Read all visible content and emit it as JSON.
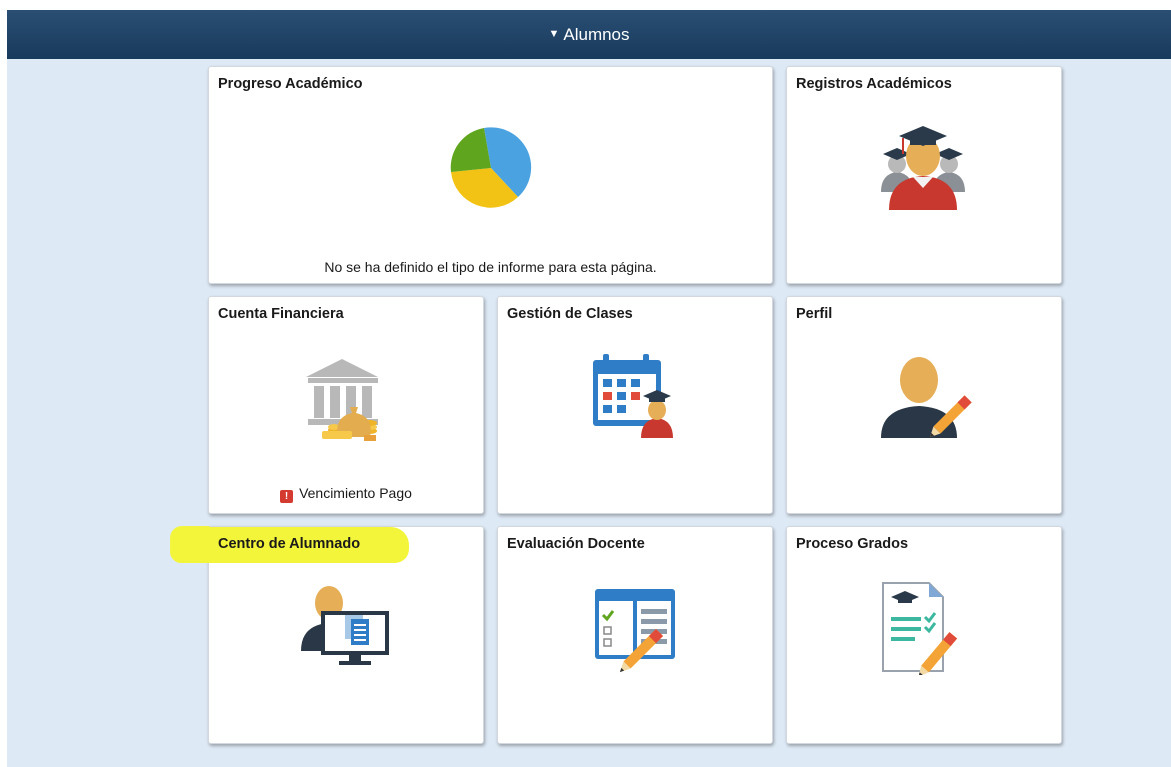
{
  "header": {
    "title": "Alumnos",
    "caret_icon": "caret-down-icon"
  },
  "tiles": {
    "progreso": {
      "title": "Progreso Académico",
      "icon": "pie-chart-icon",
      "footer": "No se ha definido el tipo de informe para esta página."
    },
    "registros": {
      "title": "Registros Académicos",
      "icon": "graduates-icon"
    },
    "cuenta": {
      "title": "Cuenta Financiera",
      "icon": "bank-money-icon",
      "alert_glyph": "!",
      "footer": "Vencimiento Pago"
    },
    "gestion": {
      "title": "Gestión de Clases",
      "icon": "calendar-student-icon"
    },
    "perfil": {
      "title": "Perfil",
      "icon": "profile-edit-icon"
    },
    "centro": {
      "title": "Centro de Alumnado",
      "icon": "student-computer-icon"
    },
    "evaluacion": {
      "title": "Evaluación Docente",
      "icon": "checklist-edit-icon"
    },
    "proceso": {
      "title": "Proceso Grados",
      "icon": "graduation-document-icon"
    }
  },
  "colors": {
    "header": "#1f4568",
    "page_bg": "#dde9f5",
    "highlight": "#f3f53a",
    "alert": "#d43a2f"
  }
}
